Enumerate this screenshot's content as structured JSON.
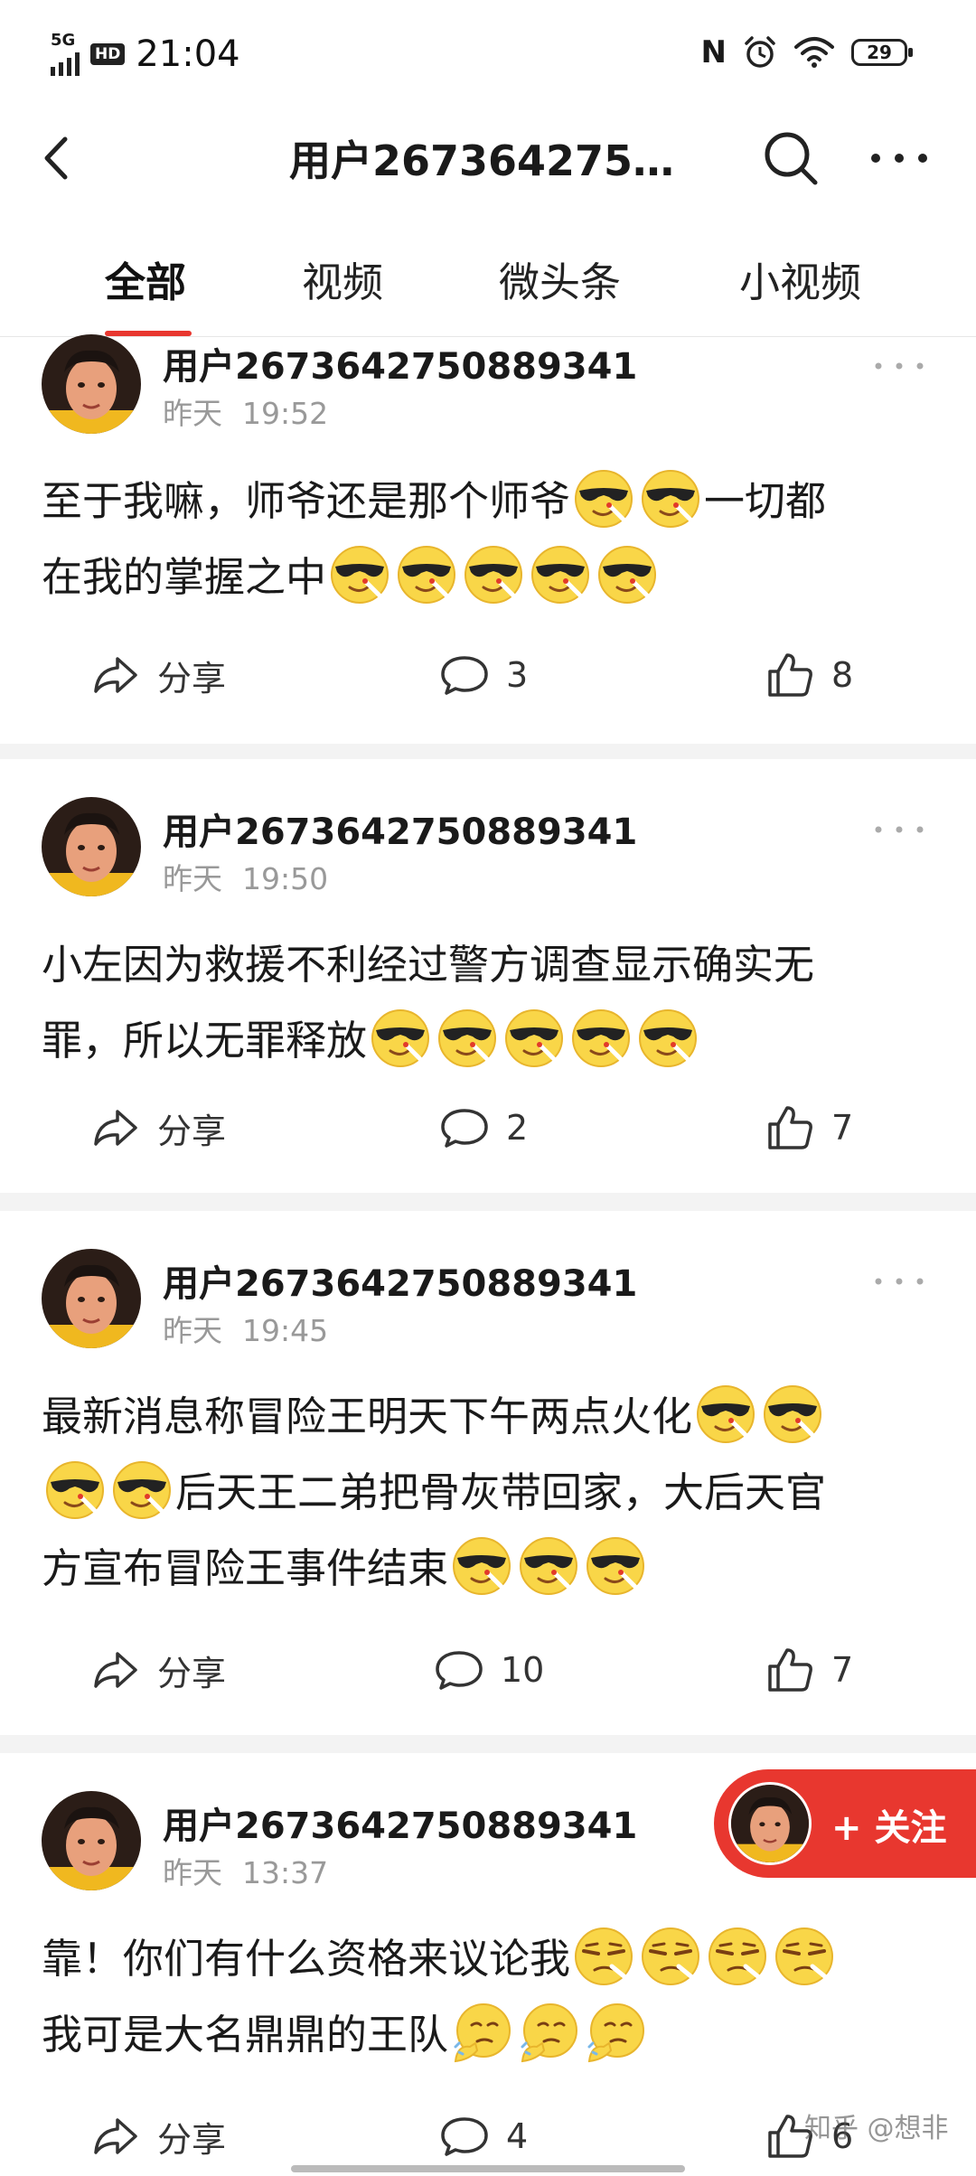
{
  "status_bar": {
    "network": "5G",
    "hd": "HD",
    "time": "21:04",
    "nfc": "N",
    "battery": "29"
  },
  "header": {
    "title": "用户267364275…"
  },
  "tabs": [
    {
      "label": "全部",
      "active": true
    },
    {
      "label": "视频"
    },
    {
      "label": "微头条"
    },
    {
      "label": "小视频"
    }
  ],
  "posts": [
    {
      "user": "用户2673642750889341",
      "date": "昨天",
      "time": "19:52",
      "lines": [
        "至于我嘛，师爷还是那个师爷",
        "一切都",
        "在我的掌握之中"
      ],
      "share_label": "分享",
      "comments": "3",
      "likes": "8"
    },
    {
      "user": "用户2673642750889341",
      "date": "昨天",
      "time": "19:50",
      "lines": [
        "小左因为救援不利经过警方调查显示确实无",
        "罪，所以无罪释放"
      ],
      "share_label": "分享",
      "comments": "2",
      "likes": "7"
    },
    {
      "user": "用户2673642750889341",
      "date": "昨天",
      "time": "19:45",
      "lines": [
        "最新消息称冒险王明天下午两点火化",
        "后天王二弟把骨灰带回家，大后天官",
        "方宣布冒险王事件结束"
      ],
      "share_label": "分享",
      "comments": "10",
      "likes": "7"
    },
    {
      "user": "用户2673642750889341",
      "date": "昨天",
      "time": "13:37",
      "lines": [
        "靠！你们有什么资格来议论我",
        "我可是大名鼎鼎的王队"
      ],
      "share_label": "分享",
      "comments": "4",
      "likes": "6"
    }
  ],
  "follow_button": {
    "label": "+ 关注"
  },
  "watermark": "知乎 @想非",
  "colors": {
    "accent": "#e8372f",
    "secondary_text": "#999999",
    "divider": "#f3f3f3"
  },
  "icons": [
    "back-arrow-icon",
    "search-icon",
    "more-icon",
    "share-icon",
    "comment-icon",
    "like-icon",
    "sunglasses-emoji",
    "smirk-emoji",
    "thinking-emoji"
  ]
}
